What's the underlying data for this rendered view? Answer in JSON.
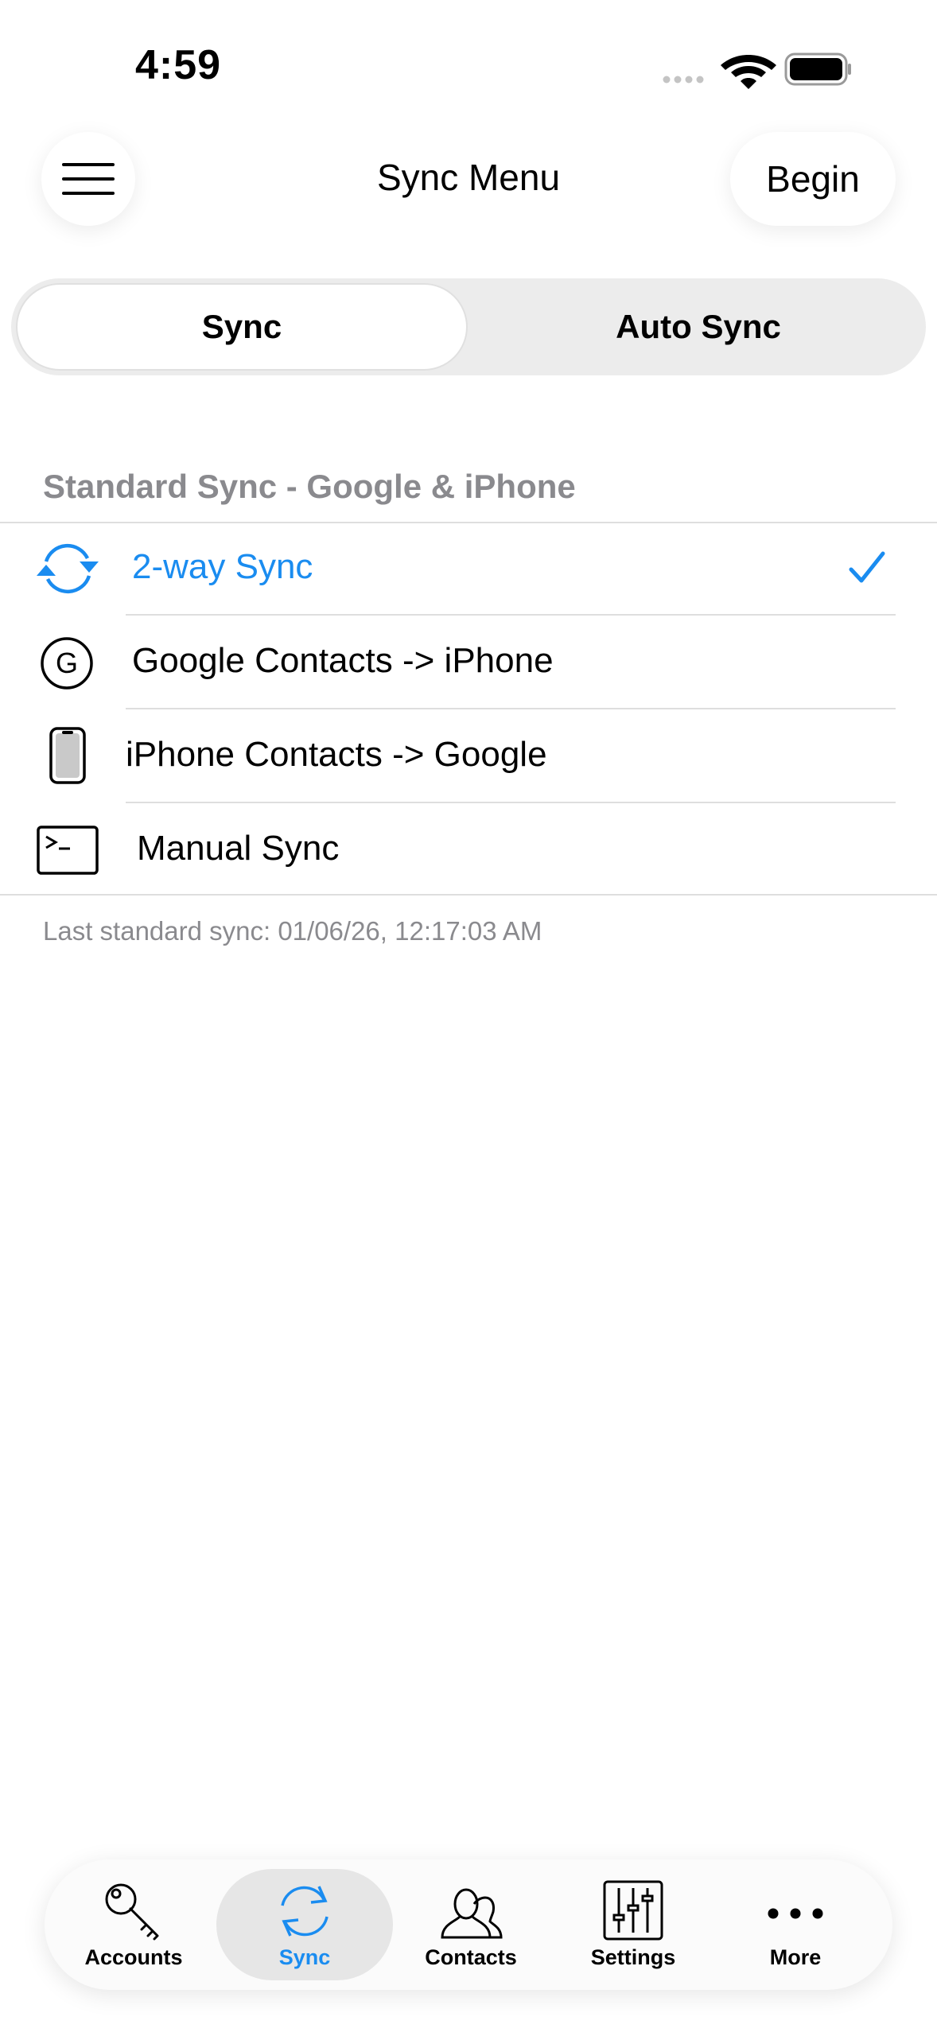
{
  "status_bar": {
    "time": "4:59"
  },
  "nav": {
    "title": "Sync Menu",
    "begin_label": "Begin",
    "menu_icon": "hamburger-icon"
  },
  "segmented": {
    "options": [
      "Sync",
      "Auto Sync"
    ],
    "selected": "Sync"
  },
  "section": {
    "header": "Standard Sync - Google & iPhone",
    "items": [
      {
        "label": "2-way Sync",
        "icon": "sync-arrows-icon",
        "selected": true
      },
      {
        "label": "Google Contacts -> iPhone",
        "icon": "google-g-icon",
        "selected": false
      },
      {
        "label": "iPhone Contacts -> Google",
        "icon": "iphone-icon",
        "selected": false
      },
      {
        "label": "Manual Sync",
        "icon": "terminal-icon",
        "selected": false
      }
    ],
    "footer": "Last standard sync: 01/06/26, 12:17:03 AM"
  },
  "tabbar": {
    "tabs": [
      {
        "label": "Accounts",
        "icon": "key-icon"
      },
      {
        "label": "Sync",
        "icon": "sync-icon",
        "active": true
      },
      {
        "label": "Contacts",
        "icon": "people-icon"
      },
      {
        "label": "Settings",
        "icon": "sliders-icon"
      },
      {
        "label": "More",
        "icon": "ellipsis-icon"
      }
    ]
  },
  "colors": {
    "accent": "#1a8cf0",
    "secondary_text": "#8a8a8e",
    "separator": "#dedede"
  }
}
